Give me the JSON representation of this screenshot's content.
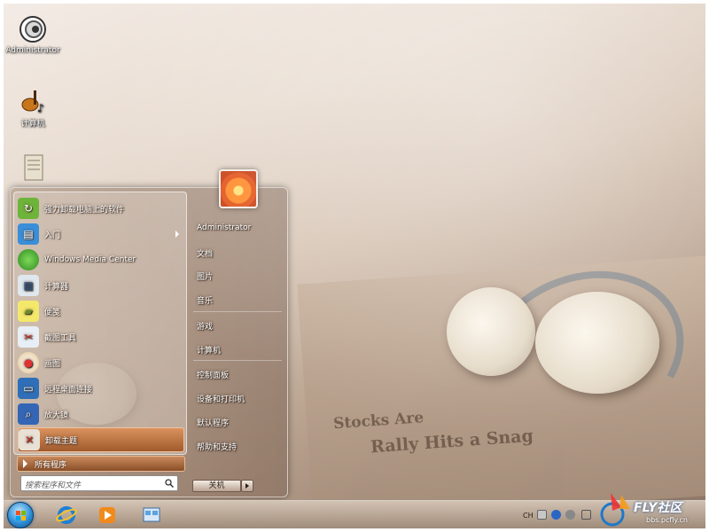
{
  "desktop": {
    "icons": [
      {
        "label": "Administrator",
        "icon": "user-folder-icon"
      },
      {
        "label": "计算机",
        "icon": "computer-icon"
      },
      {
        "label": "",
        "icon": "document-icon"
      }
    ]
  },
  "start_menu": {
    "programs": [
      {
        "label": "强力卸载电脑上的软件",
        "icon": "uninstall-icon"
      },
      {
        "label": "入门",
        "icon": "getting-started-icon"
      },
      {
        "label": "Windows Media Center",
        "icon": "media-center-icon"
      },
      {
        "label": "计算器",
        "icon": "calculator-icon"
      },
      {
        "label": "便笺",
        "icon": "sticky-notes-icon"
      },
      {
        "label": "截图工具",
        "icon": "snipping-tool-icon"
      },
      {
        "label": "画图",
        "icon": "paint-icon"
      },
      {
        "label": "远程桌面连接",
        "icon": "remote-desktop-icon"
      },
      {
        "label": "放大镜",
        "icon": "magnifier-icon"
      },
      {
        "label": "卸载主题",
        "icon": "uninstall-theme-icon"
      }
    ],
    "all_programs": "所有程序",
    "search_placeholder": "搜索程序和文件",
    "right_items": [
      "Administrator",
      "文档",
      "图片",
      "音乐",
      "游戏",
      "计算机",
      "控制面板",
      "设备和打印机",
      "默认程序",
      "帮助和支持"
    ],
    "shutdown_label": "关机"
  },
  "taskbar": {
    "pinned": [
      "internet-explorer-icon",
      "media-player-icon",
      "explorer-icon"
    ],
    "tray": {
      "language": "CH"
    }
  },
  "watermark": {
    "brand": "FLY社区",
    "url": "bbs.pcfly.cn"
  },
  "newspaper": {
    "headline1": "Stocks Are",
    "headline2": "Rally Hits a Snag"
  }
}
